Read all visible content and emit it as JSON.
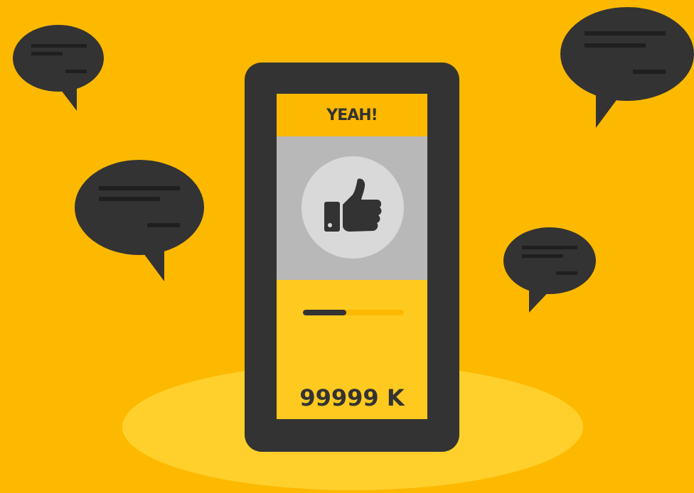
{
  "colors": {
    "background": "#FDB900",
    "spotlight": "#FFD02C",
    "phone_frame": "#333333",
    "screen_header": "#FDB900",
    "screen_body": "#FFCA1F",
    "photo_area": "#B8B8B8",
    "like_circle": "#D9D9D9",
    "dark": "#333333"
  },
  "phone": {
    "header_text": "YEAH!",
    "like_icon": "thumbs-up-icon",
    "progress_fraction": 0.43,
    "count_text": "99999 K"
  },
  "bubbles": [
    {
      "icon": "speech-bubble-icon"
    },
    {
      "icon": "speech-bubble-icon"
    },
    {
      "icon": "speech-bubble-icon"
    },
    {
      "icon": "speech-bubble-icon"
    }
  ]
}
